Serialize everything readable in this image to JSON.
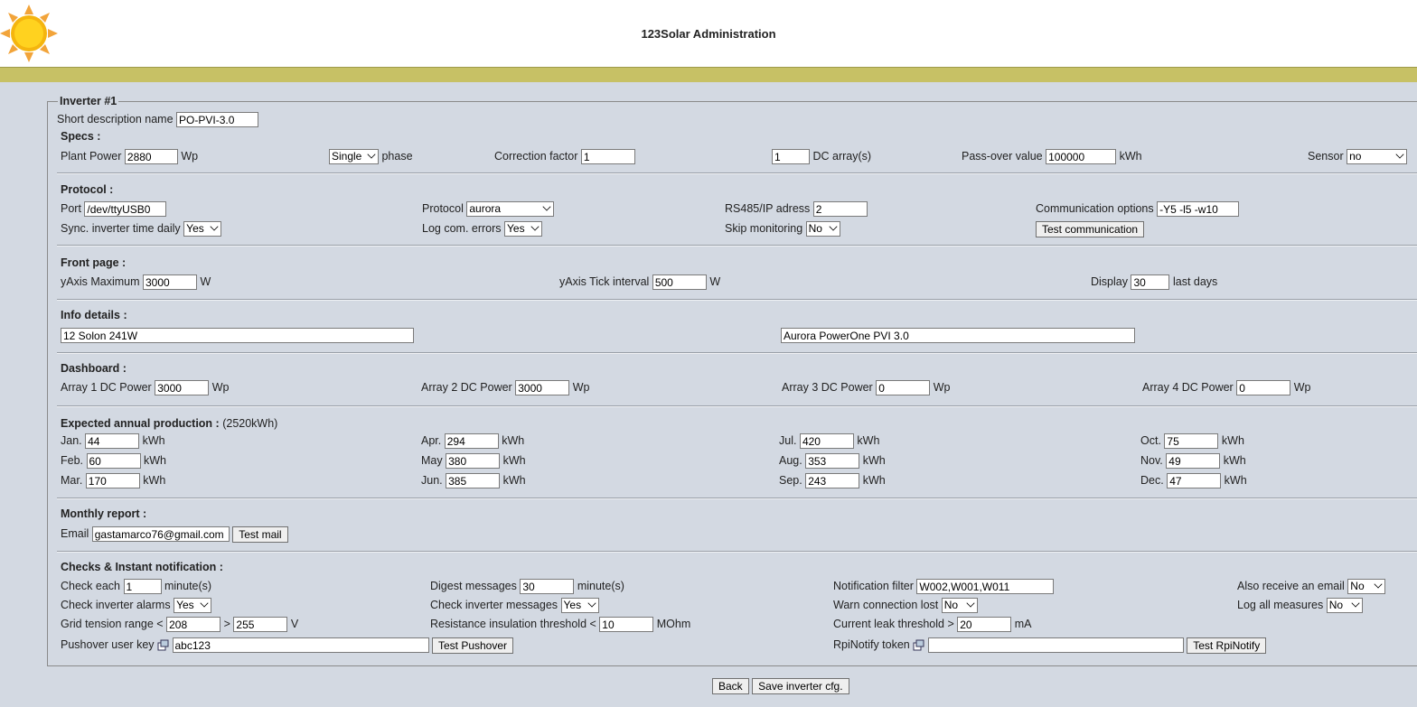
{
  "header": {
    "title": "123Solar Administration"
  },
  "inverter": {
    "legend": "Inverter #1",
    "short_desc_label": "Short description name",
    "short_desc_value": "PO-PVI-3.0"
  },
  "specs": {
    "title": "Specs :",
    "plant_power_label": "Plant Power",
    "plant_power_value": "2880",
    "plant_power_unit": "Wp",
    "phase_value": "Single",
    "phase_label": "phase",
    "correction_label": "Correction factor",
    "correction_value": "1",
    "dc_arrays_value": "1",
    "dc_arrays_label": "DC array(s)",
    "passover_label": "Pass-over value",
    "passover_value": "100000",
    "passover_unit": "kWh",
    "sensor_label": "Sensor",
    "sensor_value": "no"
  },
  "protocol": {
    "title": "Protocol :",
    "port_label": "Port",
    "port_value": "/dev/ttyUSB0",
    "protocol_label": "Protocol",
    "protocol_value": "aurora",
    "rs485_label": "RS485/IP adress",
    "rs485_value": "2",
    "comm_label": "Communication options",
    "comm_value": "-Y5 -l5 -w10",
    "sync_label": "Sync. inverter time daily",
    "sync_value": "Yes",
    "logcom_label": "Log com. errors",
    "logcom_value": "Yes",
    "skip_label": "Skip monitoring",
    "skip_value": "No",
    "test_comm_button": "Test communication"
  },
  "front_page": {
    "title": "Front page :",
    "ymax_label": "yAxis Maximum",
    "ymax_value": "3000",
    "ymax_unit": "W",
    "ytick_label": "yAxis Tick interval",
    "ytick_value": "500",
    "ytick_unit": "W",
    "display_label": "Display",
    "display_value": "30",
    "display_unit": "last days"
  },
  "info": {
    "title": "Info details :",
    "field1": "12 Solon 241W",
    "field2": "Aurora PowerOne PVI 3.0"
  },
  "dashboard": {
    "title": "Dashboard :",
    "arrays": [
      {
        "label": "Array 1 DC Power",
        "value": "3000",
        "unit": "Wp"
      },
      {
        "label": "Array 2 DC Power",
        "value": "3000",
        "unit": "Wp"
      },
      {
        "label": "Array 3 DC Power",
        "value": "0",
        "unit": "Wp"
      },
      {
        "label": "Array 4 DC Power",
        "value": "0",
        "unit": "Wp"
      }
    ]
  },
  "expected": {
    "title": "Expected annual production :",
    "total": "(2520kWh)",
    "unit": "kWh",
    "months": [
      {
        "label": "Jan.",
        "value": "44"
      },
      {
        "label": "Feb.",
        "value": "60"
      },
      {
        "label": "Mar.",
        "value": "170"
      },
      {
        "label": "Apr.",
        "value": "294"
      },
      {
        "label": "May",
        "value": "380"
      },
      {
        "label": "Jun.",
        "value": "385"
      },
      {
        "label": "Jul.",
        "value": "420"
      },
      {
        "label": "Aug.",
        "value": "353"
      },
      {
        "label": "Sep.",
        "value": "243"
      },
      {
        "label": "Oct.",
        "value": "75"
      },
      {
        "label": "Nov.",
        "value": "49"
      },
      {
        "label": "Dec.",
        "value": "47"
      }
    ]
  },
  "monthly": {
    "title": "Monthly report :",
    "email_label": "Email",
    "email_value": "gastamarco76@gmail.com",
    "test_mail_button": "Test mail"
  },
  "checks": {
    "title": "Checks & Instant notification :",
    "check_each_label": "Check each",
    "check_each_value": "1",
    "check_each_unit": "minute(s)",
    "digest_label": "Digest messages",
    "digest_value": "30",
    "digest_unit": "minute(s)",
    "notif_filter_label": "Notification filter",
    "notif_filter_value": "W002,W001,W011",
    "also_email_label": "Also receive an email",
    "also_email_value": "No",
    "alarms_label": "Check inverter alarms",
    "alarms_value": "Yes",
    "messages_label": "Check inverter messages",
    "messages_value": "Yes",
    "warn_conn_label": "Warn connection lost",
    "warn_conn_value": "No",
    "log_all_label": "Log all measures",
    "log_all_value": "No",
    "grid_label": "Grid tension range <",
    "grid_min": "208",
    "grid_gt": ">",
    "grid_max": "255",
    "grid_unit": "V",
    "resist_label": "Resistance insulation threshold <",
    "resist_value": "10",
    "resist_unit": "MOhm",
    "leak_label": "Current leak threshold >",
    "leak_value": "20",
    "leak_unit": "mA",
    "pushover_label": "Pushover user key",
    "pushover_value": "abc123",
    "pushover_button": "Test Pushover",
    "rpi_label": "RpiNotify token",
    "rpi_value": "",
    "rpi_button": "Test RpiNotify"
  },
  "footer": {
    "back_button": "Back",
    "save_button": "Save inverter cfg."
  }
}
